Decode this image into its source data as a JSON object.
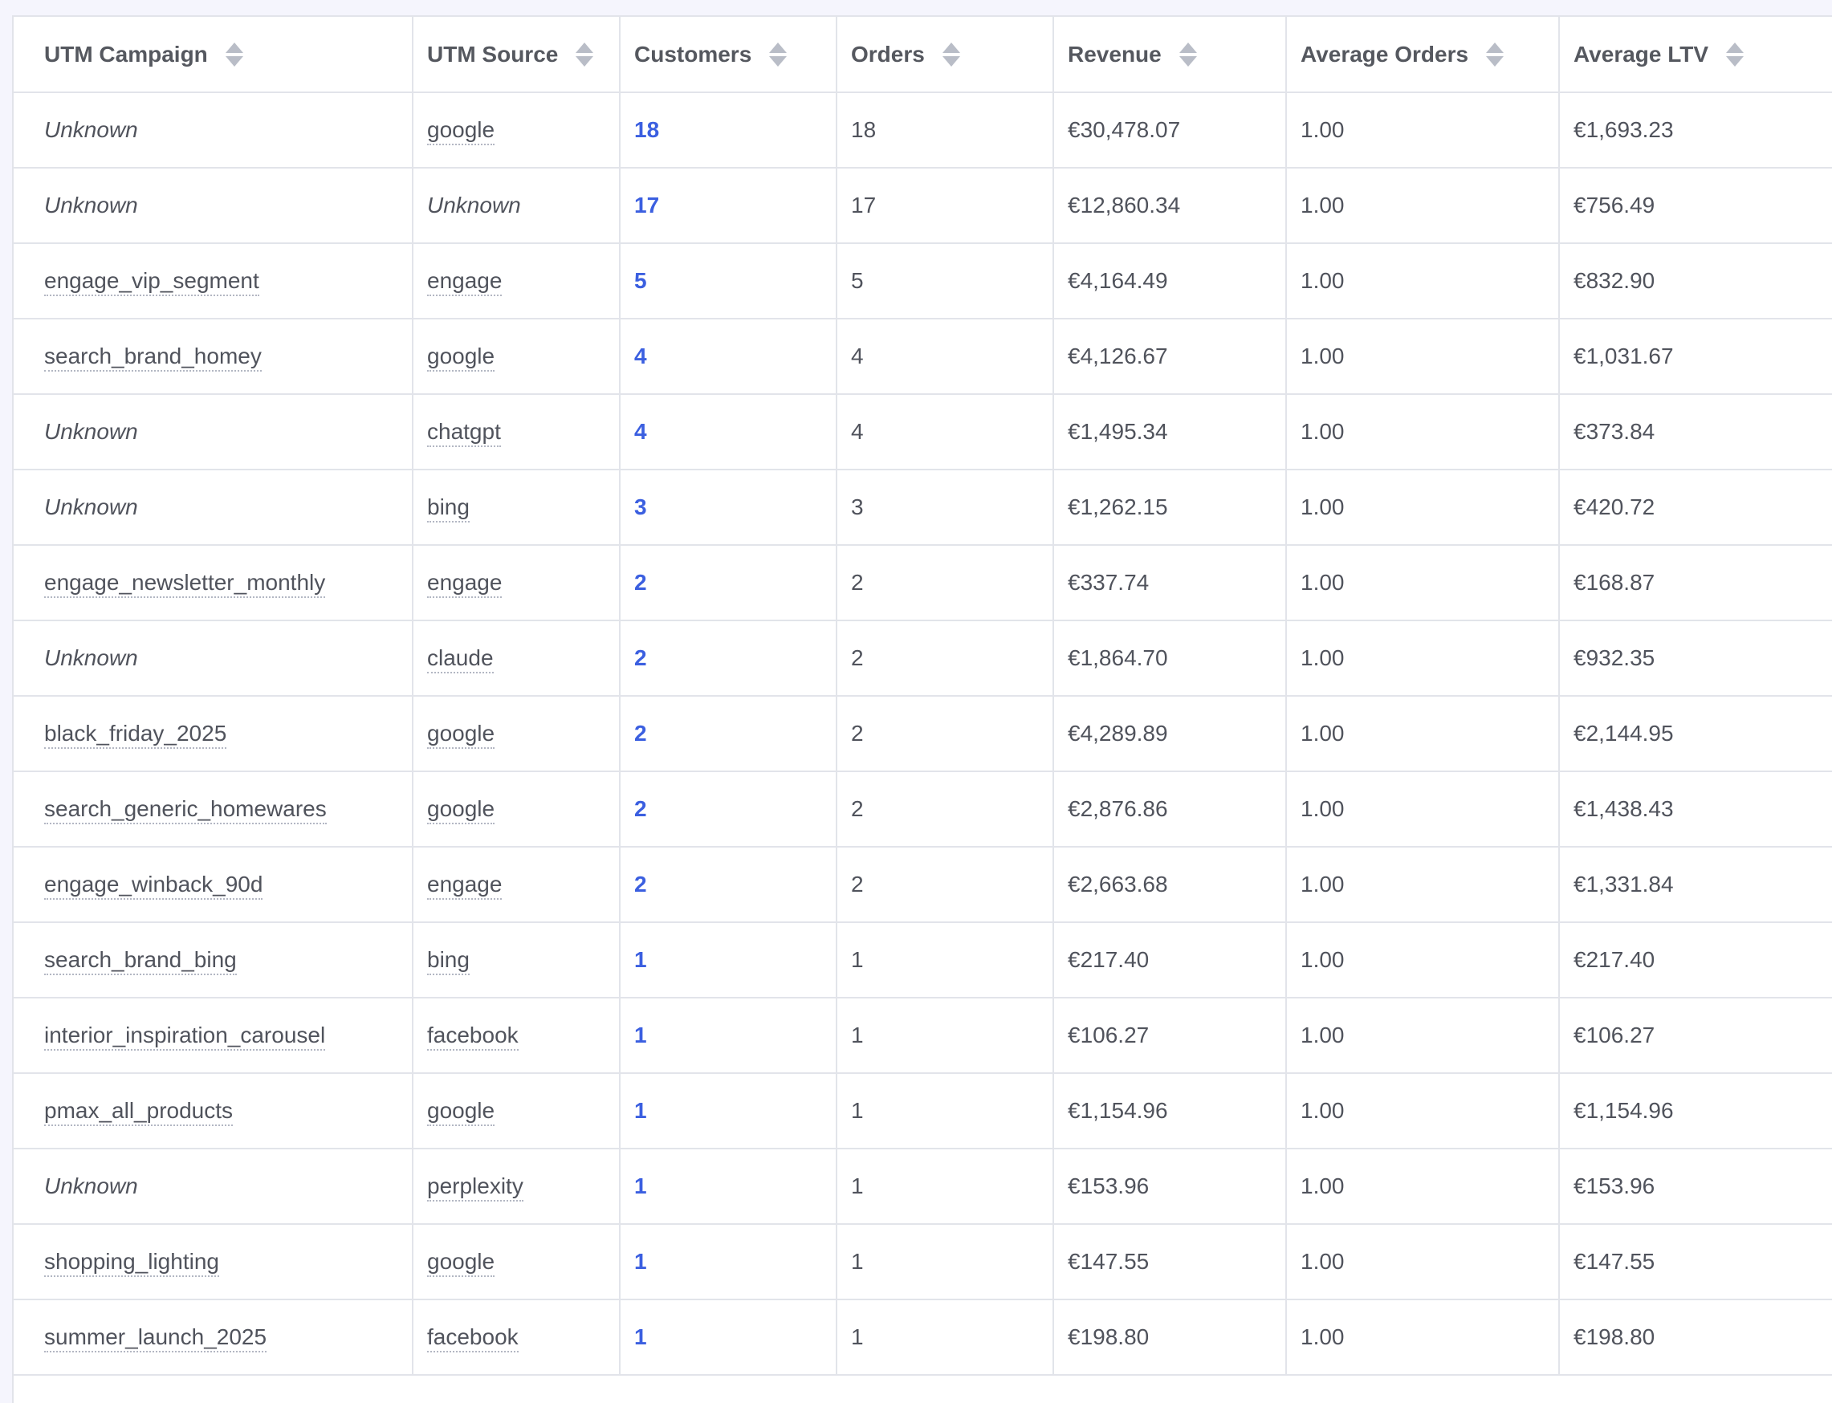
{
  "table": {
    "headers": [
      "UTM Campaign",
      "UTM Source",
      "Customers",
      "Orders",
      "Revenue",
      "Average Orders",
      "Average LTV"
    ],
    "rows": [
      {
        "campaign": "Unknown",
        "source": "google",
        "customers": "18",
        "orders": "18",
        "revenue": "€30,478.07",
        "avg_orders": "1.00",
        "avg_ltv": "€1,693.23"
      },
      {
        "campaign": "Unknown",
        "source": "Unknown",
        "customers": "17",
        "orders": "17",
        "revenue": "€12,860.34",
        "avg_orders": "1.00",
        "avg_ltv": "€756.49"
      },
      {
        "campaign": "engage_vip_segment",
        "source": "engage",
        "customers": "5",
        "orders": "5",
        "revenue": "€4,164.49",
        "avg_orders": "1.00",
        "avg_ltv": "€832.90"
      },
      {
        "campaign": "search_brand_homey",
        "source": "google",
        "customers": "4",
        "orders": "4",
        "revenue": "€4,126.67",
        "avg_orders": "1.00",
        "avg_ltv": "€1,031.67"
      },
      {
        "campaign": "Unknown",
        "source": "chatgpt",
        "customers": "4",
        "orders": "4",
        "revenue": "€1,495.34",
        "avg_orders": "1.00",
        "avg_ltv": "€373.84"
      },
      {
        "campaign": "Unknown",
        "source": "bing",
        "customers": "3",
        "orders": "3",
        "revenue": "€1,262.15",
        "avg_orders": "1.00",
        "avg_ltv": "€420.72"
      },
      {
        "campaign": "engage_newsletter_monthly",
        "source": "engage",
        "customers": "2",
        "orders": "2",
        "revenue": "€337.74",
        "avg_orders": "1.00",
        "avg_ltv": "€168.87"
      },
      {
        "campaign": "Unknown",
        "source": "claude",
        "customers": "2",
        "orders": "2",
        "revenue": "€1,864.70",
        "avg_orders": "1.00",
        "avg_ltv": "€932.35"
      },
      {
        "campaign": "black_friday_2025",
        "source": "google",
        "customers": "2",
        "orders": "2",
        "revenue": "€4,289.89",
        "avg_orders": "1.00",
        "avg_ltv": "€2,144.95"
      },
      {
        "campaign": "search_generic_homewares",
        "source": "google",
        "customers": "2",
        "orders": "2",
        "revenue": "€2,876.86",
        "avg_orders": "1.00",
        "avg_ltv": "€1,438.43"
      },
      {
        "campaign": "engage_winback_90d",
        "source": "engage",
        "customers": "2",
        "orders": "2",
        "revenue": "€2,663.68",
        "avg_orders": "1.00",
        "avg_ltv": "€1,331.84"
      },
      {
        "campaign": "search_brand_bing",
        "source": "bing",
        "customers": "1",
        "orders": "1",
        "revenue": "€217.40",
        "avg_orders": "1.00",
        "avg_ltv": "€217.40"
      },
      {
        "campaign": "interior_inspiration_carousel",
        "source": "facebook",
        "customers": "1",
        "orders": "1",
        "revenue": "€106.27",
        "avg_orders": "1.00",
        "avg_ltv": "€106.27"
      },
      {
        "campaign": "pmax_all_products",
        "source": "google",
        "customers": "1",
        "orders": "1",
        "revenue": "€1,154.96",
        "avg_orders": "1.00",
        "avg_ltv": "€1,154.96"
      },
      {
        "campaign": "Unknown",
        "source": "perplexity",
        "customers": "1",
        "orders": "1",
        "revenue": "€153.96",
        "avg_orders": "1.00",
        "avg_ltv": "€153.96"
      },
      {
        "campaign": "shopping_lighting",
        "source": "google",
        "customers": "1",
        "orders": "1",
        "revenue": "€147.55",
        "avg_orders": "1.00",
        "avg_ltv": "€147.55"
      },
      {
        "campaign": "summer_launch_2025",
        "source": "facebook",
        "customers": "1",
        "orders": "1",
        "revenue": "€198.80",
        "avg_orders": "1.00",
        "avg_ltv": "€198.80"
      }
    ]
  },
  "colors": {
    "accent_link": "#3b5fe0",
    "text": "#50535c",
    "border": "#e2e4ea",
    "page_background": "#f5f5fd"
  },
  "icons": {
    "sort": "sort-arrows-icon"
  }
}
